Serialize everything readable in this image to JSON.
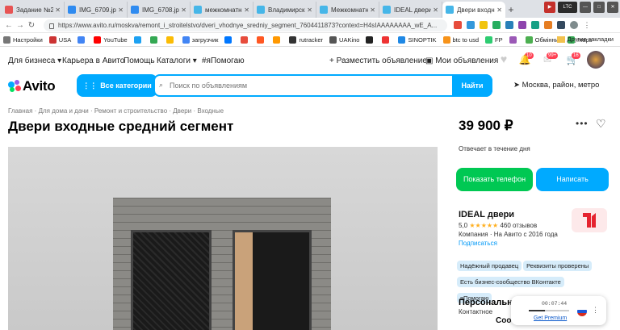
{
  "browser": {
    "tabs": [
      {
        "label": "Задание №29",
        "icon": "sp-icon",
        "color": "#e75454",
        "active": false
      },
      {
        "label": "IMG_6709.jpg",
        "icon": "drive-icon",
        "color": "#2f8bf0",
        "active": false
      },
      {
        "label": "IMG_6708.jpg",
        "icon": "drive-icon",
        "color": "#2f8bf0",
        "active": false
      },
      {
        "label": "межкомнатные",
        "icon": "avito-icon",
        "color": "#46b6e8",
        "active": false
      },
      {
        "label": "Владимирские",
        "icon": "avito-icon",
        "color": "#46b6e8",
        "active": false
      },
      {
        "label": "Межкомнатные",
        "icon": "avito-icon",
        "color": "#46b6e8",
        "active": false
      },
      {
        "label": "IDEAL двери",
        "icon": "avito-icon",
        "color": "#46b6e8",
        "active": false
      },
      {
        "label": "Двери входные",
        "icon": "avito-icon",
        "color": "#46b6e8",
        "active": true
      }
    ],
    "url": "https://www.avito.ru/moskva/remont_i_stroitelstvo/dveri_vhodnye_sredniy_segment_7604411873?context=H4sIAAAAAAAA_wE_A...",
    "bookmarks": [
      "Настройки",
      "USA",
      "",
      "YouTube",
      "",
      "",
      "",
      "загрузчик",
      "",
      "",
      "",
      "",
      "rutracker",
      "UAKino",
      "",
      "",
      "SINOPTIK",
      "btc to usd",
      "FP",
      "",
      "Обмінник",
      "maps"
    ],
    "bookmarks_right": "Другие закладки"
  },
  "topnav": {
    "business": "Для бизнеса",
    "career": "Карьера в Авито",
    "help": "Помощь",
    "catalogs": "Каталоги",
    "tag": "#яПомогаю",
    "post_ad": "Разместить объявление",
    "my_ads": "Мои объявления",
    "fav_count": "10",
    "msg_count": "99+",
    "cart_count": "16"
  },
  "header": {
    "logo": "Avito",
    "categories": "Все категории",
    "search_placeholder": "Поиск по объявлениям",
    "search_button": "Найти",
    "location": "Москва, район, метро"
  },
  "listing": {
    "breadcrumbs": [
      "Главная",
      "Для дома и дачи",
      "Ремонт и строительство",
      "Двери",
      "Входные"
    ],
    "title": "Двери входные средний сегмент",
    "price": "39 900 ₽",
    "reply_time": "Отвечает в течение дня",
    "show_phone": "Показать телефон",
    "write": "Написать"
  },
  "seller": {
    "name": "IDEAL двери",
    "rating": "5,0",
    "stars": "★★★★★",
    "reviews": "460 отзывов",
    "type": "Компания · На Авито с 2016 года",
    "subscribe": "Подписаться",
    "badges": [
      "Надёжный продавец",
      "Реквизиты проверены",
      "Есть бизнес-сообщество ВКонтакте",
      "яПомогаю"
    ],
    "personal": "Персональны",
    "contact": "Контактное",
    "soo": "Соо"
  },
  "popup": {
    "time": "00:07:44",
    "premium": "Get Premium"
  },
  "colors": {
    "accent": "#00aaff",
    "green": "#00c853",
    "red": "#ff4053"
  }
}
